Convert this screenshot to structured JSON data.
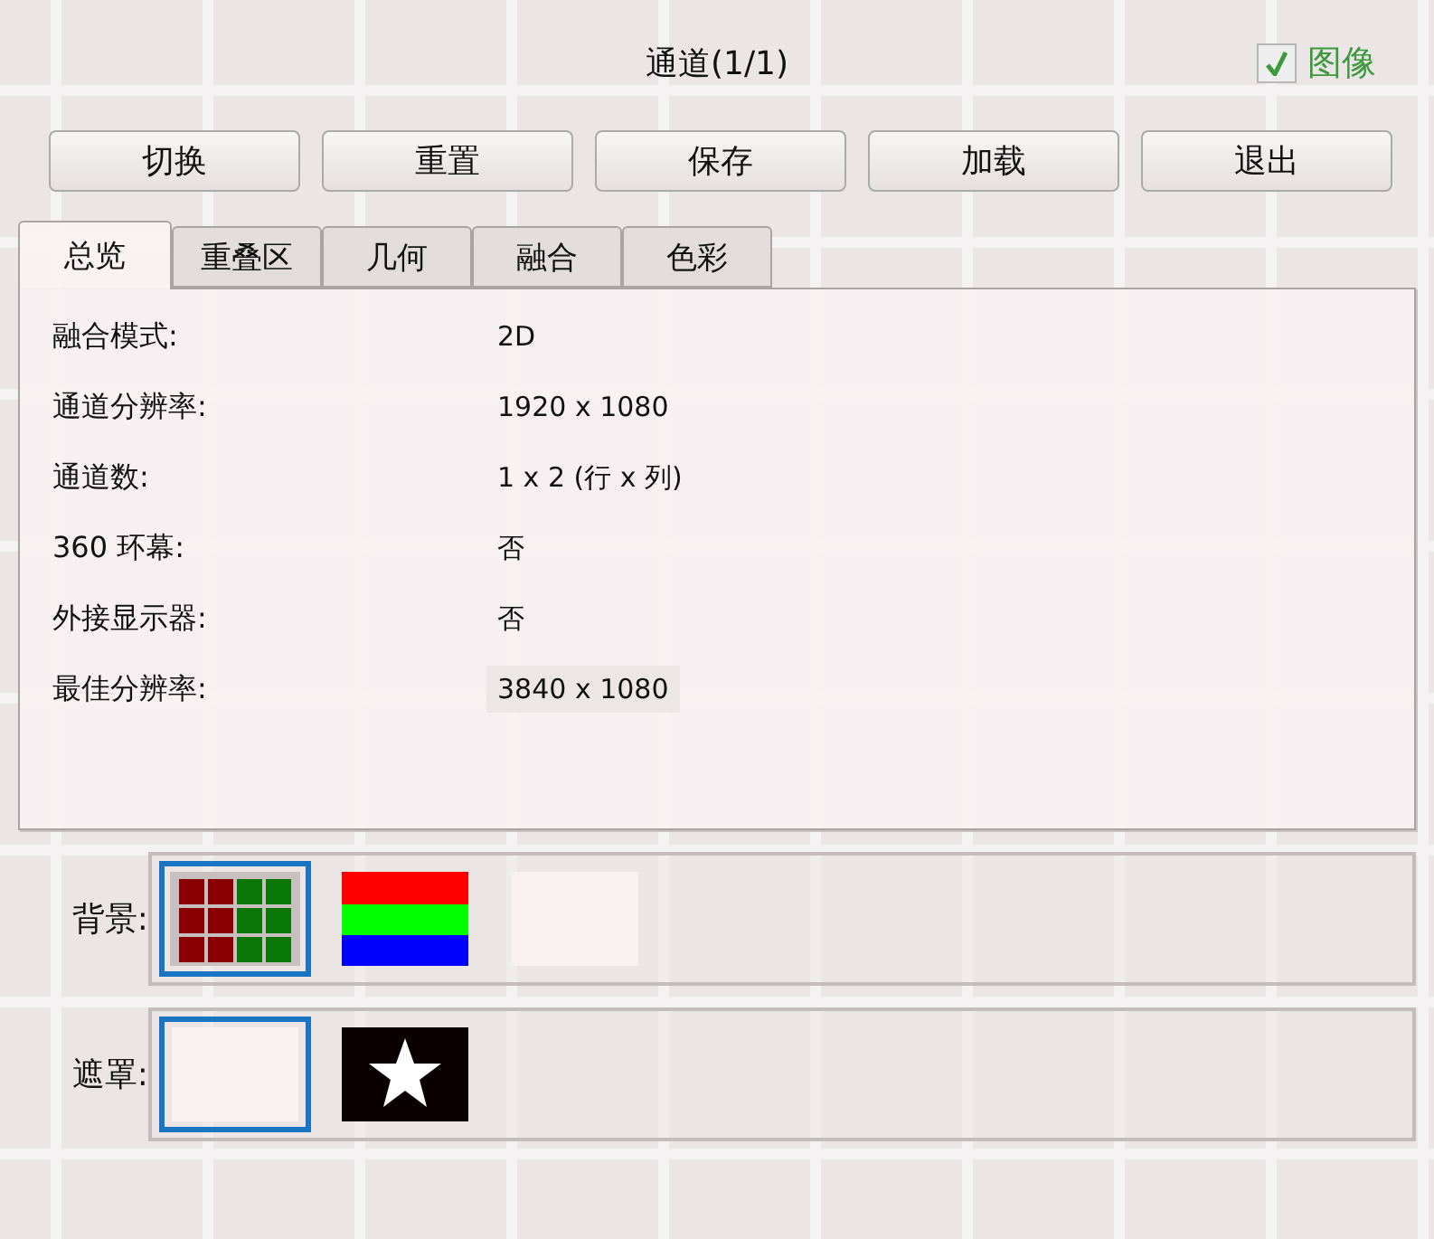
{
  "title": "通道(1/1)",
  "image_toggle": {
    "label": "图像",
    "checked": true
  },
  "buttons": [
    "切换",
    "重置",
    "保存",
    "加载",
    "退出"
  ],
  "tabs": [
    {
      "label": "总览",
      "selected": true
    },
    {
      "label": "重叠区",
      "selected": false
    },
    {
      "label": "几何",
      "selected": false
    },
    {
      "label": "融合",
      "selected": false
    },
    {
      "label": "色彩",
      "selected": false
    }
  ],
  "overview": [
    {
      "label": "融合模式:",
      "value": "2D",
      "highlighted": false
    },
    {
      "label": "通道分辨率:",
      "value": "1920 x 1080",
      "highlighted": false
    },
    {
      "label": "通道数:",
      "value": "1 x 2 (行 x 列)",
      "highlighted": false
    },
    {
      "label": "360 环幕:",
      "value": "否",
      "highlighted": false
    },
    {
      "label": "外接显示器:",
      "value": "否",
      "highlighted": false
    },
    {
      "label": "最佳分辨率:",
      "value": "3840 x 1080",
      "highlighted": true
    }
  ],
  "background": {
    "label": "背景:",
    "options": [
      {
        "kind": "grid",
        "selected": true
      },
      {
        "kind": "bars",
        "selected": false
      },
      {
        "kind": "blank",
        "selected": false
      }
    ]
  },
  "mask": {
    "label": "遮罩:",
    "options": [
      {
        "kind": "blank",
        "selected": true
      },
      {
        "kind": "star",
        "selected": false
      }
    ]
  }
}
